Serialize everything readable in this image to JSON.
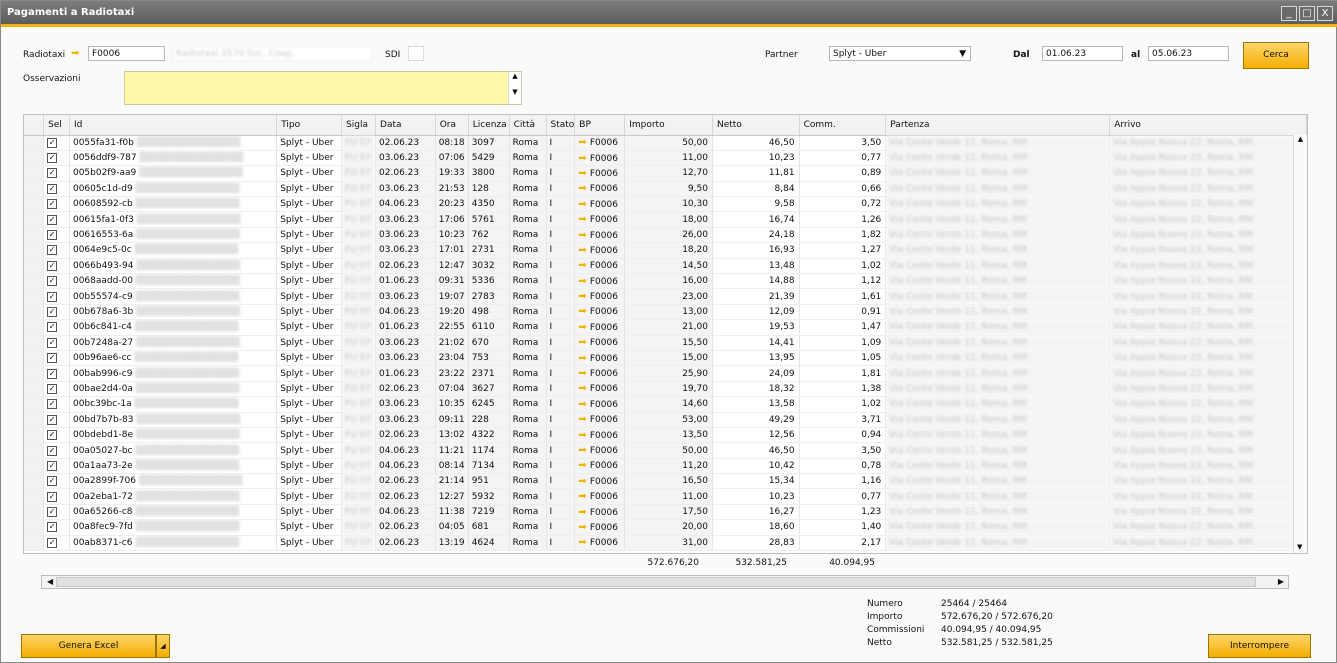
{
  "window": {
    "title": "Pagamenti a Radiotaxi",
    "minimize": "_",
    "maximize": "□",
    "close": "X"
  },
  "form": {
    "radiotaxi_label": "Radiotaxi",
    "radiotaxi_value": "F0006",
    "radiotaxi_name": "Radiotaxi 3570 Soc. Coop.",
    "sdi_label": "SDI",
    "sdi_value": "",
    "partner_label": "Partner",
    "partner_value": "Splyt - Uber",
    "dal_label": "Dal",
    "dal_value": "01.06.23",
    "al_label": "al",
    "al_value": "05.06.23",
    "search_button": "Cerca",
    "obs_label": "Osservazioni",
    "obs_value": ""
  },
  "table": {
    "headers": [
      "Sel",
      "Id",
      "Tipo",
      "Sigla",
      "Data",
      "Ora",
      "Licenza",
      "Città",
      "Stato",
      "BP",
      "Importo",
      "Netto",
      "Comm.",
      "Partenza",
      "Arrivo"
    ],
    "rows": [
      [
        "0055fa31-f0b",
        "Splyt - Uber",
        "02.06.23",
        "08:18",
        "3097",
        "50,00",
        "46,50",
        "3,50"
      ],
      [
        "0056ddf9-787",
        "Splyt - Uber",
        "03.06.23",
        "07:06",
        "5429",
        "11,00",
        "10,23",
        "0,77"
      ],
      [
        "005b02f9-aa9",
        "Splyt - Uber",
        "02.06.23",
        "19:33",
        "3800",
        "12,70",
        "11,81",
        "0,89"
      ],
      [
        "00605c1d-d9",
        "Splyt - Uber",
        "03.06.23",
        "21:53",
        "128",
        "9,50",
        "8,84",
        "0,66"
      ],
      [
        "00608592-cb",
        "Splyt - Uber",
        "04.06.23",
        "20:23",
        "4350",
        "10,30",
        "9,58",
        "0,72"
      ],
      [
        "00615fa1-0f3",
        "Splyt - Uber",
        "03.06.23",
        "17:06",
        "5761",
        "18,00",
        "16,74",
        "1,26"
      ],
      [
        "00616553-6a",
        "Splyt - Uber",
        "03.06.23",
        "10:23",
        "762",
        "26,00",
        "24,18",
        "1,82"
      ],
      [
        "0064e9c5-0c",
        "Splyt - Uber",
        "03.06.23",
        "17:01",
        "2731",
        "18,20",
        "16,93",
        "1,27"
      ],
      [
        "0066b493-94",
        "Splyt - Uber",
        "02.06.23",
        "12:47",
        "3032",
        "14,50",
        "13,48",
        "1,02"
      ],
      [
        "0068aadd-00",
        "Splyt - Uber",
        "01.06.23",
        "09:31",
        "5336",
        "16,00",
        "14,88",
        "1,12"
      ],
      [
        "00b55574-c9",
        "Splyt - Uber",
        "03.06.23",
        "19:07",
        "2783",
        "23,00",
        "21,39",
        "1,61"
      ],
      [
        "00b678a6-3b",
        "Splyt - Uber",
        "04.06.23",
        "19:20",
        "498",
        "13,00",
        "12,09",
        "0,91"
      ],
      [
        "00b6c841-c4",
        "Splyt - Uber",
        "01.06.23",
        "22:55",
        "6110",
        "21,00",
        "19,53",
        "1,47"
      ],
      [
        "00b7248a-27",
        "Splyt - Uber",
        "03.06.23",
        "21:02",
        "670",
        "15,50",
        "14,41",
        "1,09"
      ],
      [
        "00b96ae6-cc",
        "Splyt - Uber",
        "03.06.23",
        "23:04",
        "753",
        "15,00",
        "13,95",
        "1,05"
      ],
      [
        "00bab996-c9",
        "Splyt - Uber",
        "01.06.23",
        "23:22",
        "2371",
        "25,90",
        "24,09",
        "1,81"
      ],
      [
        "00bae2d4-0a",
        "Splyt - Uber",
        "02.06.23",
        "07:04",
        "3627",
        "19,70",
        "18,32",
        "1,38"
      ],
      [
        "00bc39bc-1a",
        "Splyt - Uber",
        "03.06.23",
        "10:35",
        "6245",
        "14,60",
        "13,58",
        "1,02"
      ],
      [
        "00bd7b7b-83",
        "Splyt - Uber",
        "03.06.23",
        "09:11",
        "228",
        "53,00",
        "49,29",
        "3,71"
      ],
      [
        "00bdebd1-8e",
        "Splyt - Uber",
        "02.06.23",
        "13:02",
        "4322",
        "13,50",
        "12,56",
        "0,94"
      ],
      [
        "00a05027-bc",
        "Splyt - Uber",
        "04.06.23",
        "11:21",
        "1174",
        "50,00",
        "46,50",
        "3,50"
      ],
      [
        "00a1aa73-2e",
        "Splyt - Uber",
        "04.06.23",
        "08:14",
        "7134",
        "11,20",
        "10,42",
        "0,78"
      ],
      [
        "00a2899f-706",
        "Splyt - Uber",
        "02.06.23",
        "21:14",
        "951",
        "16,50",
        "15,34",
        "1,16"
      ],
      [
        "00a2eba1-72",
        "Splyt - Uber",
        "02.06.23",
        "12:27",
        "5932",
        "11,00",
        "10,23",
        "0,77"
      ],
      [
        "00a65266-c8",
        "Splyt - Uber",
        "04.06.23",
        "11:38",
        "7219",
        "17,50",
        "16,27",
        "1,23"
      ],
      [
        "00a8fec9-7fd",
        "Splyt - Uber",
        "02.06.23",
        "04:05",
        "681",
        "20,00",
        "18,60",
        "1,40"
      ],
      [
        "00ab8371-c6",
        "Splyt - Uber",
        "02.06.23",
        "13:19",
        "4624",
        "31,00",
        "28,83",
        "2,17"
      ]
    ],
    "city": "Roma",
    "stato": "I",
    "bp": "F0006",
    "check": "✓",
    "blurred_sigla": "FU 07",
    "blurred_partenza": "Via Conte Verde 11, Roma, RM",
    "blurred_arrivo": "Via Appia Nuova 22, Roma, RM",
    "totals": {
      "importo": "572.676,20",
      "netto": "532.581,25",
      "comm": "40.094,95"
    }
  },
  "stats": {
    "numero_label": "Numero",
    "numero": "25464 / 25464",
    "importo_label": "Importo",
    "importo": "572.676,20 / 572.676,20",
    "commissioni_label": "Commissioni",
    "commissioni": "40.094,95 / 40.094,95",
    "netto_label": "Netto",
    "netto": "532.581,25 / 532.581,25"
  },
  "buttons": {
    "excel": "Genera Excel",
    "stop": "Interrompere"
  },
  "colors": {
    "accent": "#f2b300",
    "notes": "#fff8a8"
  }
}
